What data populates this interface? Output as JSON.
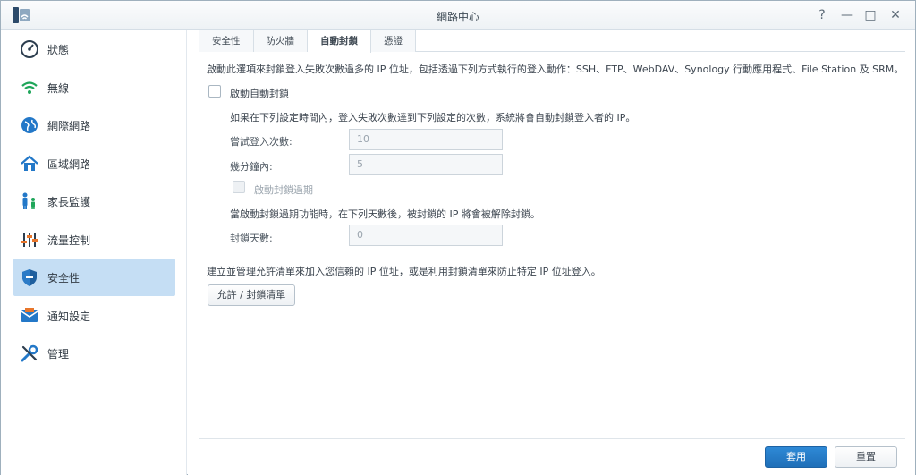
{
  "window": {
    "title": "網路中心",
    "help_glyph": "?",
    "pin_glyph": "—",
    "maximize_glyph": "□",
    "close_glyph": "✕"
  },
  "sidebar": {
    "items": [
      {
        "label": "狀態",
        "icon": "dashboard-icon"
      },
      {
        "label": "無線",
        "icon": "wifi-icon"
      },
      {
        "label": "網際網路",
        "icon": "globe-icon"
      },
      {
        "label": "區域網路",
        "icon": "house-icon"
      },
      {
        "label": "家長監護",
        "icon": "family-icon"
      },
      {
        "label": "流量控制",
        "icon": "sliders-icon"
      },
      {
        "label": "安全性",
        "icon": "shield-icon",
        "active": true
      },
      {
        "label": "通知設定",
        "icon": "mail-icon"
      },
      {
        "label": "管理",
        "icon": "tools-icon"
      }
    ]
  },
  "tabs": [
    {
      "label": "安全性"
    },
    {
      "label": "防火牆"
    },
    {
      "label": "自動封鎖",
      "active": true
    },
    {
      "label": "憑證"
    }
  ],
  "content": {
    "intro": "啟動此選項來封鎖登入失敗次數過多的 IP 位址，包括透過下列方式執行的登入動作：SSH、FTP、WebDAV、Synology 行動應用程式、File Station 及 SRM。",
    "enable_autoblock_label": "啟動自動封鎖",
    "condition_text": "如果在下列設定時間內，登入失敗次數達到下列設定的次數，系統將會自動封鎖登入者的 IP。",
    "login_attempts_label": "嘗試登入次數:",
    "login_attempts_value": "10",
    "within_minutes_label": "幾分鐘內:",
    "within_minutes_value": "5",
    "enable_expiry_label": "啟動封鎖過期",
    "expiry_text": "當啟動封鎖過期功能時，在下列天數後，被封鎖的 IP 將會被解除封鎖。",
    "block_days_label": "封鎖天數:",
    "block_days_value": "0",
    "allowlist_text": "建立並管理允許清單來加入您信賴的 IP 位址，或是利用封鎖清單來防止特定 IP 位址登入。",
    "allow_block_list_button": "允許 / 封鎖清單"
  },
  "footer": {
    "apply_label": "套用",
    "reset_label": "重置"
  },
  "colors": {
    "accent": "#2377c6",
    "active_nav": "#c5def4"
  }
}
